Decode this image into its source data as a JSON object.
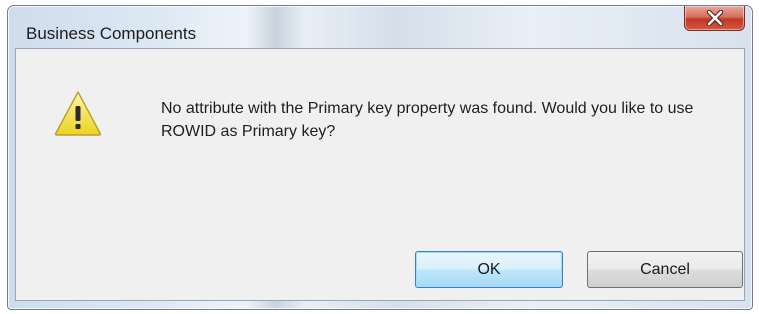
{
  "window": {
    "title": "Business Components",
    "close_icon": "close-x-icon"
  },
  "dialog": {
    "icon": "warning-icon",
    "message": "No attribute with the Primary key property was found.  Would you like to use ROWID as Primary key?"
  },
  "buttons": {
    "ok_label": "OK",
    "cancel_label": "Cancel"
  },
  "colors": {
    "close_button": "#c9412f",
    "warning_yellow": "#f7e35a",
    "dialog_background": "#f0f0f0",
    "default_button_border": "#3c7fb1"
  }
}
